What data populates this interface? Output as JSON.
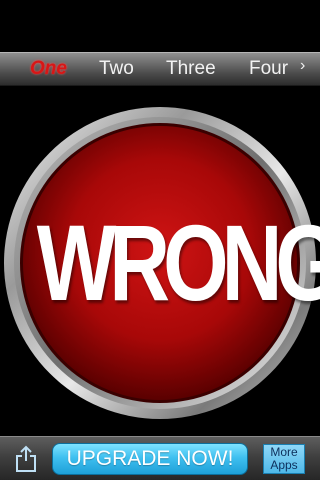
{
  "tabs": [
    {
      "label": "One",
      "active": true
    },
    {
      "label": "Two",
      "active": false
    },
    {
      "label": "Three",
      "active": false
    },
    {
      "label": "Four",
      "active": false
    }
  ],
  "tab_more_glyph": "›",
  "big_button": {
    "label": "WRONG!",
    "color": "#b50b0b",
    "rim_color": "#c9c9c9"
  },
  "toolbar": {
    "share_icon": "share-icon",
    "upgrade_label": "UPGRADE NOW!",
    "more_apps_line1": "More",
    "more_apps_line2": "Apps"
  }
}
